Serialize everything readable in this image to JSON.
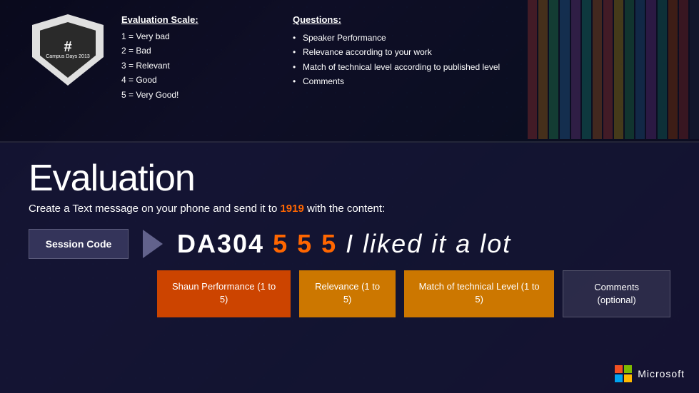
{
  "top": {
    "eval_scale": {
      "title": "Evaluation Scale:",
      "items": [
        "1 = Very bad",
        "2 = Bad",
        "3 = Relevant",
        "4 = Good",
        "5 = Very Good!"
      ]
    },
    "questions": {
      "title": "Questions:",
      "items": [
        "Speaker Performance",
        "Relevance according to your work",
        "Match of technical level according to published level",
        "Comments"
      ]
    },
    "badge": {
      "hash": "#",
      "line1": "Campus Days 2013"
    }
  },
  "bottom": {
    "heading": "Evaluation",
    "instruction": "Create a Text message on your phone and send it to",
    "number": "1919",
    "instruction_end": "with the content:",
    "session_code_label": "Session Code",
    "code_prefix": "DA304",
    "code_numbers": "5 5 5",
    "code_suffix": "I liked it a lot",
    "fields": [
      {
        "label": "Shaun Performance (1 to 5)",
        "type": "orange"
      },
      {
        "label": "Relevance (1 to 5)",
        "type": "amber"
      },
      {
        "label": "Match of technical Level (1 to 5)",
        "type": "amber"
      },
      {
        "label": "Comments (optional)",
        "type": "dark"
      }
    ]
  },
  "microsoft": {
    "label": "Microsoft"
  },
  "stripes": {
    "colors": [
      "#e74c3c",
      "#f39c12",
      "#2ecc71",
      "#3498db",
      "#9b59b6",
      "#1abc9c",
      "#e67e22",
      "#e74c3c",
      "#f1c40f",
      "#27ae60",
      "#2980b9",
      "#8e44ad",
      "#16a085",
      "#d35400",
      "#c0392b",
      "#2c3e50"
    ]
  }
}
